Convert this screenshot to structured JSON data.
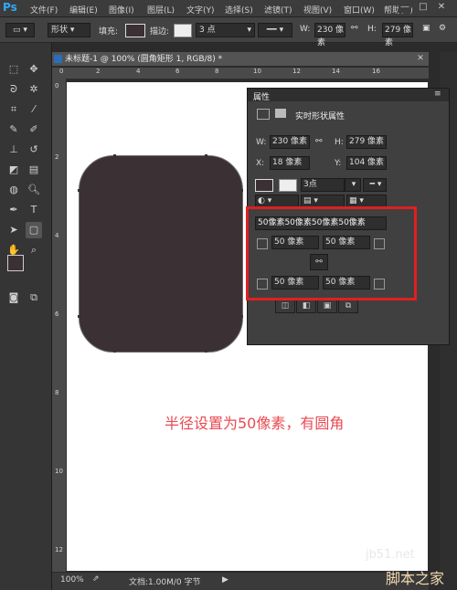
{
  "app": {
    "logo": "Ps"
  },
  "menu": [
    "文件(F)",
    "编辑(E)",
    "图像(I)",
    "图层(L)",
    "文字(Y)",
    "选择(S)",
    "滤镜(T)",
    "视图(V)",
    "窗口(W)",
    "帮助(H)"
  ],
  "window_controls": {
    "minimize": "—",
    "maximize": "□",
    "close": "✕"
  },
  "options_bar": {
    "mode": "形状",
    "fill_label": "填充:",
    "stroke_label": "描边:",
    "stroke_width": "3 点",
    "w_label": "W:",
    "w_value": "230 像素",
    "h_label": "H:",
    "h_value": "279 像素"
  },
  "document": {
    "tab_title": "未标题-1 @ 100% (圆角矩形 1, RGB/8) *",
    "ruler_marks": [
      "0",
      "2",
      "4",
      "6",
      "8",
      "10",
      "12",
      "14",
      "16"
    ],
    "zoom": "100%",
    "doc_info": "文档:1.00M/0 字节"
  },
  "properties": {
    "tab": "属性",
    "title": "实时形状属性",
    "w_label": "W:",
    "w": "230 像素",
    "h_label": "H:",
    "h": "279 像素",
    "x_label": "X:",
    "x": "18 像素",
    "y_label": "Y:",
    "y": "104 像素",
    "stroke_width": "3点",
    "radius_all": "50像素50像素50像素50像素",
    "radius_tl": "50 像素",
    "radius_tr": "50 像素",
    "radius_bl": "50 像素",
    "radius_br": "50 像素"
  },
  "annotation": "半径设置为50像素，有圆角",
  "watermark": {
    "site": "jb51.net",
    "name": "脚本之家"
  },
  "colors": {
    "shape_fill": "#3b3034",
    "highlight": "#e01f22",
    "annotation": "#e84a52",
    "foreground": "#3b3034",
    "background": "#000000"
  }
}
